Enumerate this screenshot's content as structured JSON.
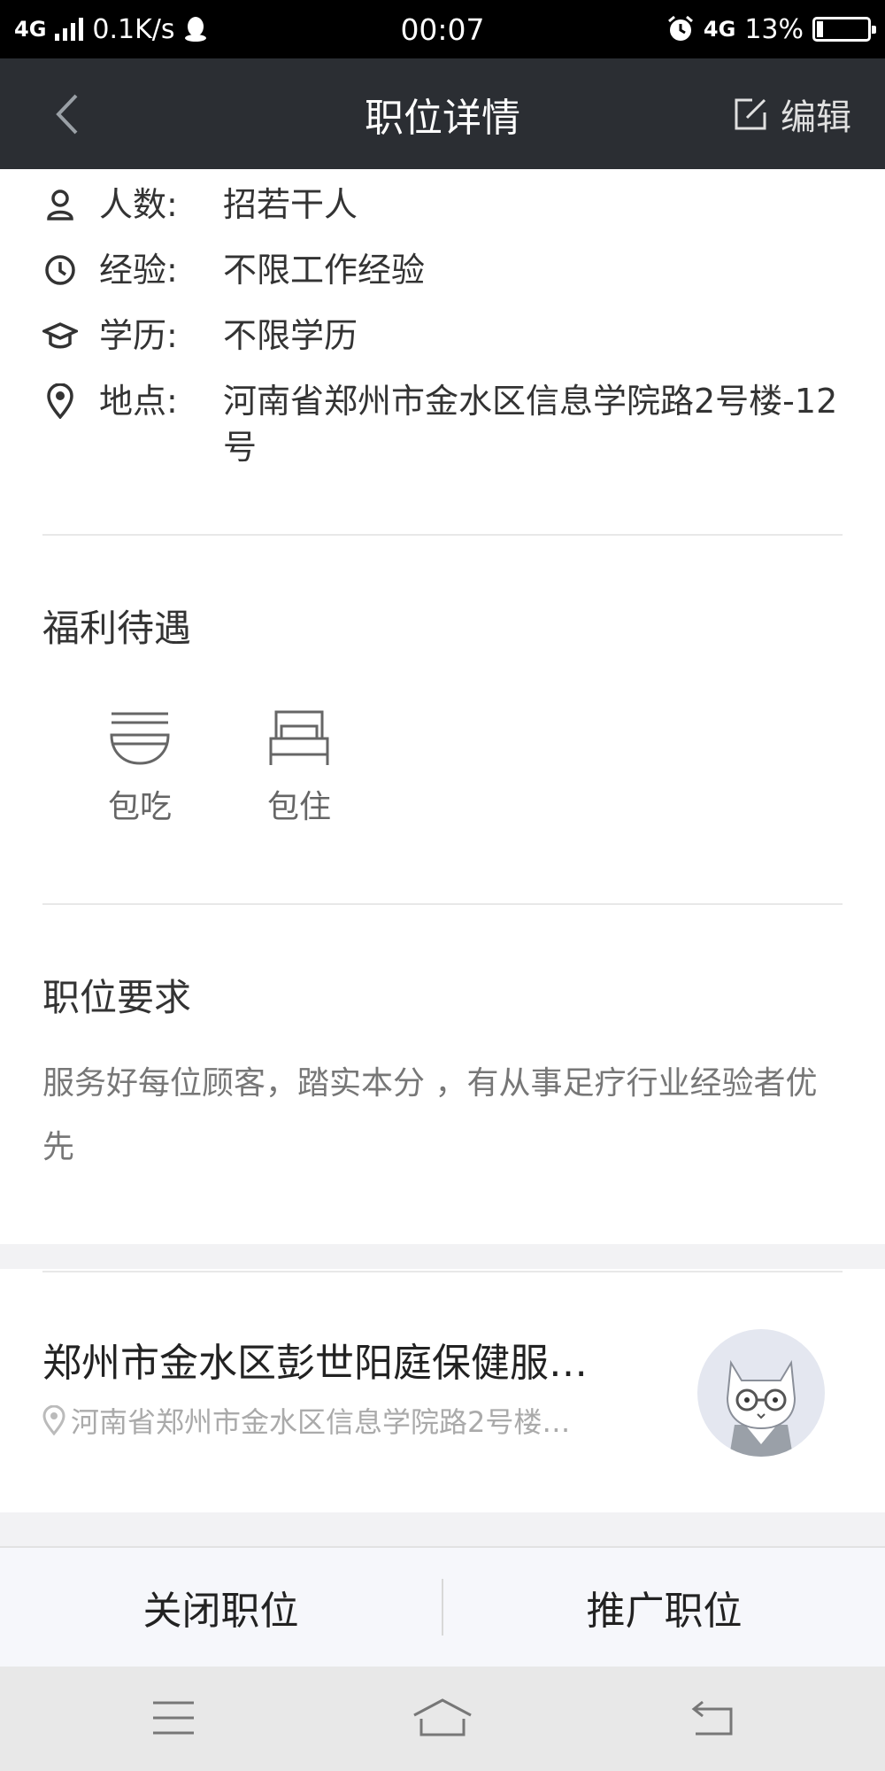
{
  "status_bar": {
    "network": "4G",
    "speed": "0.1K/s",
    "time": "00:07",
    "network_right": "4G",
    "battery_text": "13%",
    "battery_level": 0.13
  },
  "nav": {
    "title": "职位详情",
    "edit_label": "编辑"
  },
  "info": {
    "headcount": {
      "label": "人数:",
      "value": "招若干人"
    },
    "experience": {
      "label": "经验:",
      "value": "不限工作经验"
    },
    "education": {
      "label": "学历:",
      "value": "不限学历"
    },
    "location": {
      "label": "地点:",
      "value": "河南省郑州市金水区信息学院路2号楼-12号"
    }
  },
  "benefits": {
    "title": "福利待遇",
    "items": [
      {
        "label": "包吃",
        "icon": "bowl-icon"
      },
      {
        "label": "包住",
        "icon": "bed-icon"
      }
    ]
  },
  "requirements": {
    "title": "职位要求",
    "text": "服务好每位顾客，踏实本分 ，有从事足疗行业经验者优先"
  },
  "company": {
    "name": "郑州市金水区彭世阳庭保健服…",
    "address": "河南省郑州市金水区信息学院路2号楼…"
  },
  "actions": {
    "close": "关闭职位",
    "promote": "推广职位"
  },
  "colors": {
    "nav_bg": "#2b2e33",
    "status_bg": "#000000",
    "text_secondary": "#777777",
    "action_bar_bg": "#f6f7fb"
  }
}
